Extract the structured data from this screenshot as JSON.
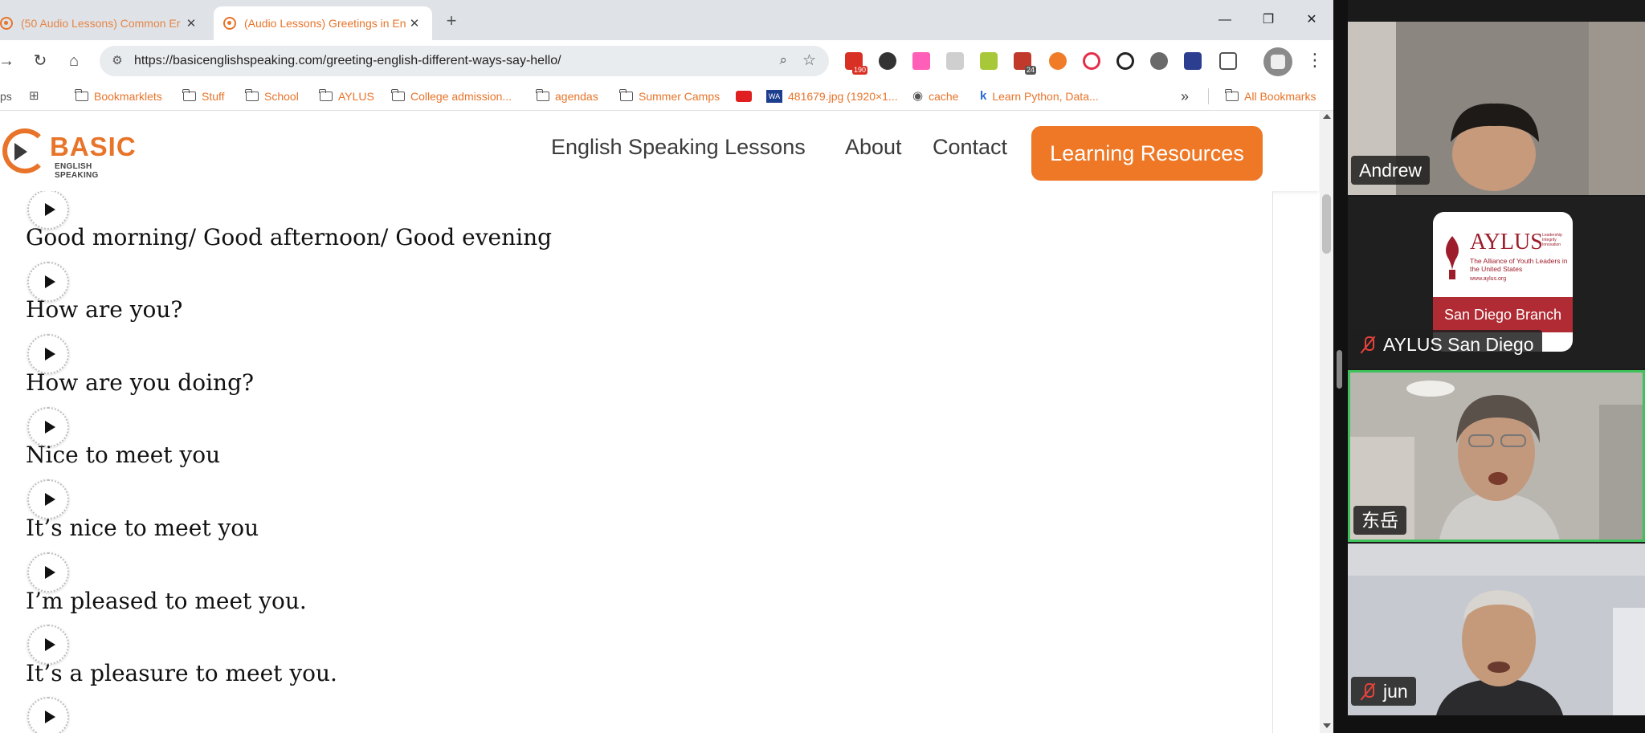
{
  "browser": {
    "tabs": [
      {
        "title": "(50 Audio Lessons) Common Er"
      },
      {
        "title": "(Audio Lessons) Greetings in En"
      }
    ],
    "url": "https://basicenglishspeaking.com/greeting-english-different-ways-say-hello/",
    "extension_badges": {
      "gmail": "190",
      "ext7": "24"
    },
    "bookmarks": [
      {
        "label": "ps",
        "kind": "text"
      },
      {
        "label": "",
        "kind": "apps"
      },
      {
        "label": "Bookmarklets",
        "kind": "folder"
      },
      {
        "label": "Stuff",
        "kind": "folder"
      },
      {
        "label": "School",
        "kind": "folder"
      },
      {
        "label": "AYLUS",
        "kind": "folder"
      },
      {
        "label": "College admission...",
        "kind": "folder"
      },
      {
        "label": "agendas",
        "kind": "folder"
      },
      {
        "label": "Summer Camps",
        "kind": "folder"
      },
      {
        "label": "",
        "kind": "youtube"
      },
      {
        "label": "481679.jpg (1920×1...",
        "kind": "wa"
      },
      {
        "label": "cache",
        "kind": "globe"
      },
      {
        "label": "Learn Python, Data...",
        "kind": "k"
      },
      {
        "label": "»",
        "kind": "more"
      },
      {
        "label": "All Bookmarks",
        "kind": "folder"
      }
    ]
  },
  "site": {
    "logo_word": "BASIC",
    "logo_sub": "ENGLISH SPEAKING",
    "nav": [
      "English Speaking Lessons",
      "About",
      "Contact"
    ],
    "cta": "Learning Resources",
    "phrases": [
      "Good morning/ Good afternoon/ Good evening",
      "How are you?",
      "How are you doing?",
      "Nice to meet you",
      "It’s nice to meet you",
      "I’m pleased to meet you.",
      "It’s a pleasure to meet you."
    ]
  },
  "zoom": {
    "participants": [
      {
        "name": "Andrew",
        "muted": false
      },
      {
        "name": "AYLUS San Diego",
        "muted": true
      },
      {
        "name": "东岳",
        "muted": false,
        "speaking": true
      },
      {
        "name": "jun",
        "muted": true
      }
    ],
    "aylus_card": {
      "brand": "AYLUS",
      "tagline": "The Alliance of Youth Leaders in the United States",
      "motto": "Leadership Integrity Innovation",
      "web": "www.aylus.org",
      "branch": "San Diego Branch"
    }
  }
}
